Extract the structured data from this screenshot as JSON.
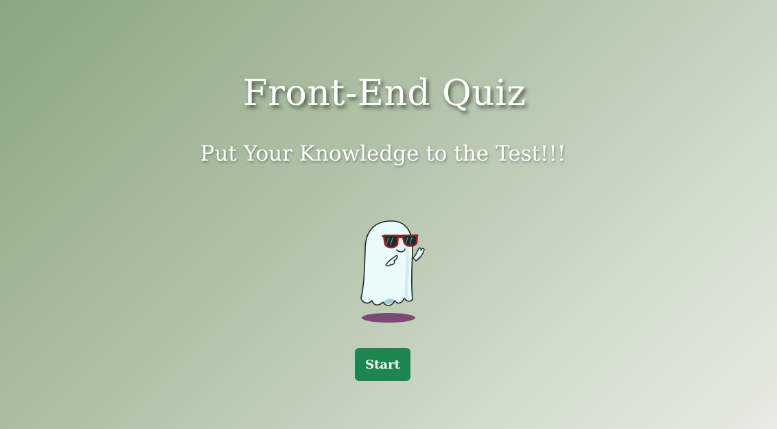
{
  "header": {
    "title": "Front-End Quiz",
    "subtitle": "Put Your Knowledge to the Test!!!"
  },
  "hero": {
    "icon": "ghost-with-sunglasses-icon"
  },
  "actions": {
    "start_label": "Start",
    "start_color": "#1c8550"
  },
  "colors": {
    "background_start": "#8aa682",
    "background_end": "#e6ebe3",
    "text": "#ffffff"
  }
}
